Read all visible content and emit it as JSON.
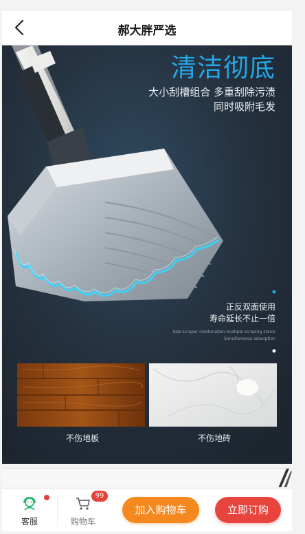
{
  "header": {
    "title": "郝大胖严选"
  },
  "hero": {
    "title": "清洁彻底",
    "subtitle_lines": [
      "大小刮槽组合 多重刮除污渍",
      "同时吸附毛发"
    ],
    "side_lines": [
      "正反双面使用",
      "寿命延长不止一倍"
    ],
    "side_en_lines": [
      "Size scraper combination multiple scraping stains",
      "Simultaneous adsorption"
    ],
    "labels": {
      "wood": "不伤地板",
      "tile": "不伤地砖"
    },
    "colors": {
      "background": "#24303d",
      "accent": "#23a7e8",
      "glow": "#33d6ff"
    }
  },
  "bottom_bar": {
    "service": {
      "label": "客服",
      "icon": "headset-icon"
    },
    "cart": {
      "label": "购物车",
      "icon": "cart-icon",
      "badge": "99"
    },
    "add_to_cart": "加入购物车",
    "buy_now": "立即订购",
    "colors": {
      "add_to_cart": "#f5891f",
      "buy_now": "#e8443e",
      "badge": "#e3423b",
      "service_icon": "#2bb673"
    }
  }
}
